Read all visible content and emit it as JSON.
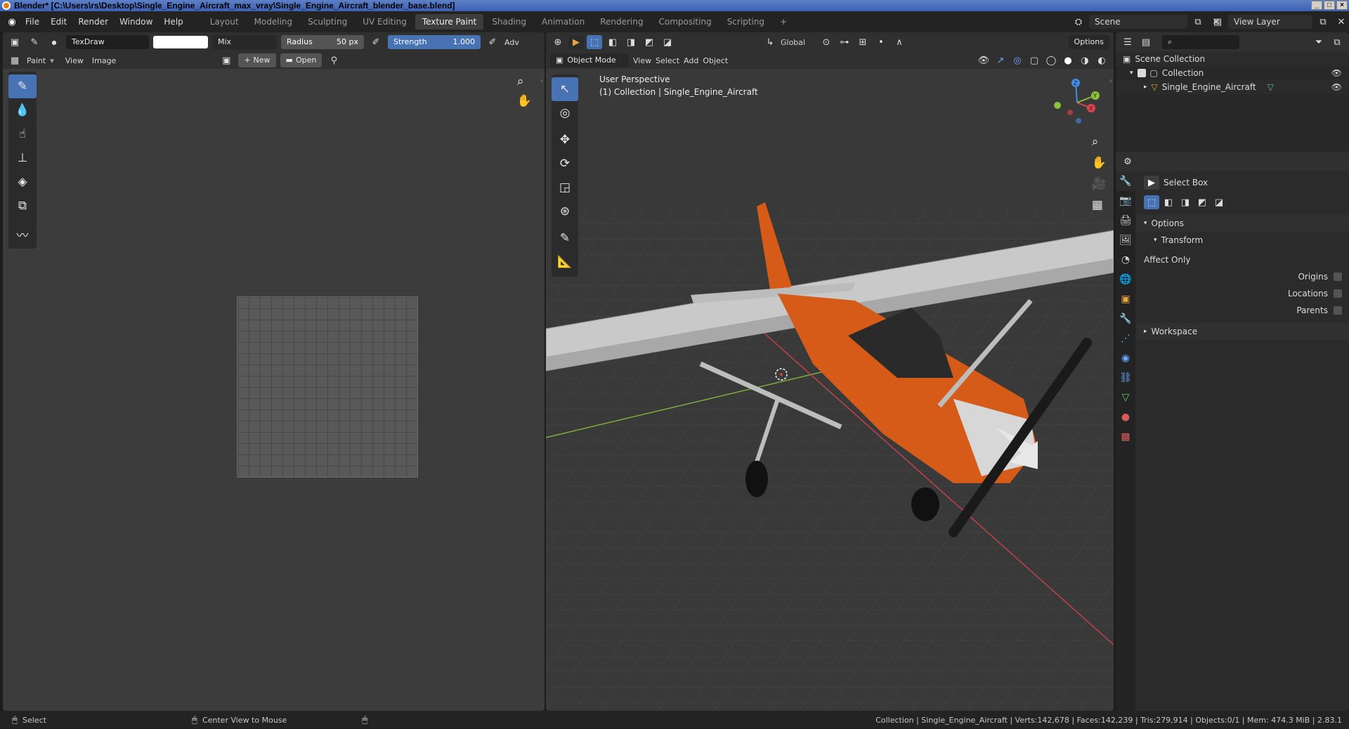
{
  "window": {
    "title": "Blender* [C:\\Users\\rs\\Desktop\\Single_Engine_Aircraft_max_vray\\Single_Engine_Aircraft_blender_base.blend]",
    "buttons": [
      "_",
      "□",
      "×"
    ]
  },
  "menu": {
    "items": [
      "File",
      "Edit",
      "Render",
      "Window",
      "Help"
    ]
  },
  "workspaces": {
    "tabs": [
      "Layout",
      "Modeling",
      "Sculpting",
      "UV Editing",
      "Texture Paint",
      "Shading",
      "Animation",
      "Rendering",
      "Compositing",
      "Scripting"
    ],
    "active": "Texture Paint",
    "add": "+"
  },
  "scene": {
    "name": "Scene",
    "view_layer": "View Layer"
  },
  "brush": {
    "name": "TexDraw",
    "blend": "Mix",
    "radius_label": "Radius",
    "radius_value": "50 px",
    "strength_label": "Strength",
    "strength_value": "1.000",
    "advanced": "Adv"
  },
  "image_editor": {
    "mode": "Paint",
    "view": "View",
    "image": "Image",
    "new": "New",
    "open": "Open"
  },
  "viewport": {
    "transform": "Global",
    "options": "Options",
    "mode": "Object Mode",
    "menus": [
      "View",
      "Select",
      "Add",
      "Object"
    ],
    "perspective": "User Perspective",
    "collection_line": "(1) Collection | Single_Engine_Aircraft",
    "gizmo_axes": [
      "X",
      "Y",
      "Z"
    ]
  },
  "outliner": {
    "root": "Scene Collection",
    "collection": "Collection",
    "object": "Single_Engine_Aircraft"
  },
  "properties": {
    "tool": "Select Box",
    "options": "Options",
    "transform": "Transform",
    "affect_only": "Affect Only",
    "origins": "Origins",
    "locations": "Locations",
    "parents": "Parents",
    "workspace": "Workspace"
  },
  "status": {
    "select": "Select",
    "center_view": "Center View to Mouse",
    "stats": "Collection | Single_Engine_Aircraft | Verts:142,678 | Faces:142,239 | Tris:279,914 | Objects:0/1 | Mem: 474.3 MiB | 2.83.1"
  },
  "colors": {
    "accent": "#4772b3",
    "aircraft_orange": "#d65a18",
    "axis_x": "#e0434f",
    "axis_y": "#8ac13a",
    "axis_z": "#3f8ee8"
  }
}
